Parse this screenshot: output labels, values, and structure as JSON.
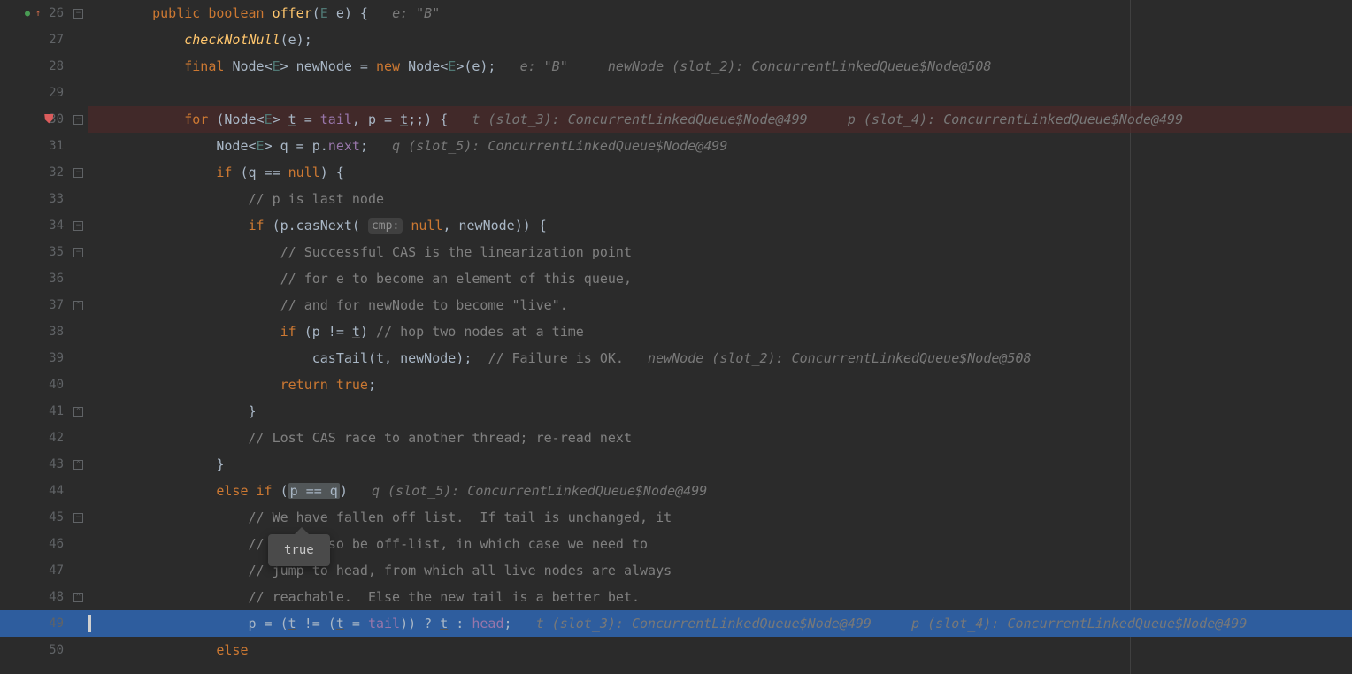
{
  "tooltip": "true",
  "lines": [
    {
      "num": "26",
      "fold": true,
      "runIcon": true,
      "runArrow": true,
      "tokens": [
        {
          "t": "    ",
          "c": ""
        },
        {
          "t": "public ",
          "c": "kw"
        },
        {
          "t": "boolean ",
          "c": "kw"
        },
        {
          "t": "offer",
          "c": "method"
        },
        {
          "t": "(",
          "c": "punct"
        },
        {
          "t": "E ",
          "c": "generic"
        },
        {
          "t": "e) {   ",
          "c": "punct"
        },
        {
          "t": "e: \"B\"",
          "c": "hint"
        }
      ]
    },
    {
      "num": "27",
      "tokens": [
        {
          "t": "        ",
          "c": ""
        },
        {
          "t": "checkNotNull",
          "c": "method-italic"
        },
        {
          "t": "(e);",
          "c": "punct"
        }
      ]
    },
    {
      "num": "28",
      "tokens": [
        {
          "t": "        ",
          "c": ""
        },
        {
          "t": "final ",
          "c": "kw"
        },
        {
          "t": "Node",
          "c": "type"
        },
        {
          "t": "<",
          "c": "punct"
        },
        {
          "t": "E",
          "c": "generic"
        },
        {
          "t": "> newNode = ",
          "c": "punct"
        },
        {
          "t": "new ",
          "c": "kw"
        },
        {
          "t": "Node",
          "c": "type"
        },
        {
          "t": "<",
          "c": "punct"
        },
        {
          "t": "E",
          "c": "generic"
        },
        {
          "t": ">(e);   ",
          "c": "punct"
        },
        {
          "t": "e: \"B\"     newNode (slot_2): ConcurrentLinkedQueue$Node@508",
          "c": "hint"
        }
      ]
    },
    {
      "num": "29",
      "tokens": []
    },
    {
      "num": "30",
      "fold": true,
      "breakpoint": true,
      "highlight": "red",
      "tokens": [
        {
          "t": "        ",
          "c": ""
        },
        {
          "t": "for ",
          "c": "kw"
        },
        {
          "t": "(Node",
          "c": "punct"
        },
        {
          "t": "<",
          "c": "punct"
        },
        {
          "t": "E",
          "c": "generic"
        },
        {
          "t": "> ",
          "c": "punct"
        },
        {
          "t": "t",
          "c": "underline"
        },
        {
          "t": " = ",
          "c": "punct"
        },
        {
          "t": "tail",
          "c": "field"
        },
        {
          "t": ", p = ",
          "c": "punct"
        },
        {
          "t": "t",
          "c": "underline"
        },
        {
          "t": ";;) {   ",
          "c": "punct"
        },
        {
          "t": "t (slot_3): ConcurrentLinkedQueue$Node@499     p (slot_4): ConcurrentLinkedQueue$Node@499",
          "c": "hint"
        }
      ]
    },
    {
      "num": "31",
      "tokens": [
        {
          "t": "            Node",
          "c": "punct"
        },
        {
          "t": "<",
          "c": "punct"
        },
        {
          "t": "E",
          "c": "generic"
        },
        {
          "t": "> q = p.",
          "c": "punct"
        },
        {
          "t": "next",
          "c": "field"
        },
        {
          "t": ";   ",
          "c": "punct"
        },
        {
          "t": "q (slot_5): ConcurrentLinkedQueue$Node@499",
          "c": "hint"
        }
      ]
    },
    {
      "num": "32",
      "fold": true,
      "tokens": [
        {
          "t": "            ",
          "c": ""
        },
        {
          "t": "if ",
          "c": "kw"
        },
        {
          "t": "(q == ",
          "c": "punct"
        },
        {
          "t": "null",
          "c": "kw"
        },
        {
          "t": ") {",
          "c": "punct"
        }
      ]
    },
    {
      "num": "33",
      "tokens": [
        {
          "t": "                ",
          "c": ""
        },
        {
          "t": "// p is last node",
          "c": "comment"
        }
      ]
    },
    {
      "num": "34",
      "fold": true,
      "tokens": [
        {
          "t": "                ",
          "c": ""
        },
        {
          "t": "if ",
          "c": "kw"
        },
        {
          "t": "(p.casNext( ",
          "c": "punct"
        },
        {
          "t": "cmp:",
          "c": "param-hint"
        },
        {
          "t": " ",
          "c": ""
        },
        {
          "t": "null",
          "c": "kw"
        },
        {
          "t": ", newNode)) {",
          "c": "punct"
        }
      ]
    },
    {
      "num": "35",
      "fold": true,
      "tokens": [
        {
          "t": "                    ",
          "c": ""
        },
        {
          "t": "// Successful CAS is the linearization point",
          "c": "comment"
        }
      ]
    },
    {
      "num": "36",
      "tokens": [
        {
          "t": "                    ",
          "c": ""
        },
        {
          "t": "// for e to become an element of this queue,",
          "c": "comment"
        }
      ]
    },
    {
      "num": "37",
      "foldEnd": true,
      "tokens": [
        {
          "t": "                    ",
          "c": ""
        },
        {
          "t": "// and for newNode to become \"live\".",
          "c": "comment"
        }
      ]
    },
    {
      "num": "38",
      "tokens": [
        {
          "t": "                    ",
          "c": ""
        },
        {
          "t": "if ",
          "c": "kw"
        },
        {
          "t": "(p != ",
          "c": "punct"
        },
        {
          "t": "t",
          "c": "underline"
        },
        {
          "t": ") ",
          "c": "punct"
        },
        {
          "t": "// hop two nodes at a time",
          "c": "comment"
        }
      ]
    },
    {
      "num": "39",
      "tokens": [
        {
          "t": "                        casTail(",
          "c": "punct"
        },
        {
          "t": "t",
          "c": "underline"
        },
        {
          "t": ", newNode);  ",
          "c": "punct"
        },
        {
          "t": "// Failure is OK.",
          "c": "comment"
        },
        {
          "t": "   ",
          "c": ""
        },
        {
          "t": "newNode (slot_2): ConcurrentLinkedQueue$Node@508",
          "c": "hint"
        }
      ]
    },
    {
      "num": "40",
      "tokens": [
        {
          "t": "                    ",
          "c": ""
        },
        {
          "t": "return ",
          "c": "kw"
        },
        {
          "t": "true",
          "c": "kw"
        },
        {
          "t": ";",
          "c": "punct"
        }
      ]
    },
    {
      "num": "41",
      "foldEnd": true,
      "tokens": [
        {
          "t": "                }",
          "c": "punct"
        }
      ]
    },
    {
      "num": "42",
      "tokens": [
        {
          "t": "                ",
          "c": ""
        },
        {
          "t": "// Lost CAS race to another thread; re-read next",
          "c": "comment"
        }
      ]
    },
    {
      "num": "43",
      "foldEnd": true,
      "tokens": [
        {
          "t": "            }",
          "c": "punct"
        }
      ]
    },
    {
      "num": "44",
      "tokens": [
        {
          "t": "            ",
          "c": ""
        },
        {
          "t": "else if ",
          "c": "kw"
        },
        {
          "t": "(",
          "c": "punct"
        },
        {
          "t": "p == q",
          "c": "hover-highlight"
        },
        {
          "t": ")   ",
          "c": "punct"
        },
        {
          "t": "q (slot_5): ConcurrentLinkedQueue$Node@499",
          "c": "hint"
        }
      ]
    },
    {
      "num": "45",
      "fold": true,
      "tokens": [
        {
          "t": "                ",
          "c": ""
        },
        {
          "t": "// We have fallen off list.  If tail is unchanged, it",
          "c": "comment"
        }
      ]
    },
    {
      "num": "46",
      "tokens": [
        {
          "t": "                ",
          "c": ""
        },
        {
          "t": "// will also be off-list, in which case we need to",
          "c": "comment"
        }
      ]
    },
    {
      "num": "47",
      "tokens": [
        {
          "t": "                ",
          "c": ""
        },
        {
          "t": "// jump to head, from which all live nodes are always",
          "c": "comment"
        }
      ]
    },
    {
      "num": "48",
      "foldEnd": true,
      "tokens": [
        {
          "t": "                ",
          "c": ""
        },
        {
          "t": "// reachable.  Else the new tail is a better bet.",
          "c": "comment"
        }
      ]
    },
    {
      "num": "49",
      "highlight": "blue",
      "execCursor": true,
      "tokens": [
        {
          "t": "                p = (",
          "c": "punct"
        },
        {
          "t": "t",
          "c": "underline"
        },
        {
          "t": " != (",
          "c": "punct"
        },
        {
          "t": "t",
          "c": "underline"
        },
        {
          "t": " = ",
          "c": "punct"
        },
        {
          "t": "tail",
          "c": "field"
        },
        {
          "t": ")) ? ",
          "c": "punct"
        },
        {
          "t": "t",
          "c": "underline"
        },
        {
          "t": " : ",
          "c": "punct"
        },
        {
          "t": "head",
          "c": "field"
        },
        {
          "t": ";   ",
          "c": "punct"
        },
        {
          "t": "t (slot_3): ConcurrentLinkedQueue$Node@499     p (slot_4): ConcurrentLinkedQueue$Node@499",
          "c": "hint"
        }
      ]
    },
    {
      "num": "50",
      "tokens": [
        {
          "t": "            ",
          "c": ""
        },
        {
          "t": "else",
          "c": "kw"
        }
      ]
    }
  ]
}
